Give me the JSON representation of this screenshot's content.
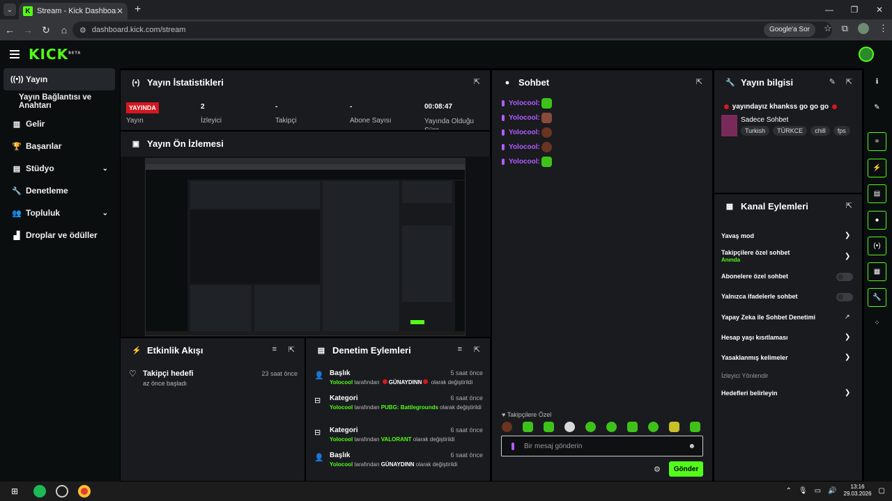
{
  "browser": {
    "tab_title": "Stream - Kick Dashboard",
    "url": "dashboard.kick.com/stream",
    "ask_google": "Google'a Sor"
  },
  "kick": {
    "logo": "KICK",
    "beta": "BETA"
  },
  "sidebar": {
    "items": [
      {
        "label": "Yayın",
        "icon": "broadcast-icon"
      },
      {
        "label": "Yayın Bağlantısı ve Anahtarı"
      },
      {
        "label": "Gelir",
        "icon": "revenue-icon"
      },
      {
        "label": "Başarılar",
        "icon": "trophy-icon"
      },
      {
        "label": "Stüdyo",
        "icon": "studio-icon"
      },
      {
        "label": "Denetleme",
        "icon": "wrench-icon"
      },
      {
        "label": "Topluluk",
        "icon": "community-icon"
      },
      {
        "label": "Droplar ve ödüller",
        "icon": "drops-icon"
      }
    ]
  },
  "stats": {
    "title": "Yayın İstatistikleri",
    "live": "YAYINDA",
    "live_label": "Yayın",
    "viewers_value": "2",
    "viewers_label": "İzleyici",
    "followers_value": "-",
    "followers_label": "Takipçi",
    "subs_value": "-",
    "subs_label": "Abone Sayısı",
    "uptime_value": "00:08:47",
    "uptime_label": "Yayında Olduğu Süre"
  },
  "preview": {
    "title": "Yayın Ön İzlemesi"
  },
  "events": {
    "title": "Etkinlik Akışı",
    "item_title": "Takipçi hedefi",
    "item_sub": "az önce başladı",
    "item_time": "23 saat önce"
  },
  "mod": {
    "title": "Denetim Eylemleri",
    "items": [
      {
        "type": "Başlık",
        "time": "5 saat önce",
        "user": "Yolocool",
        "by": "tarafından",
        "value": "GÜNAYDINN",
        "suffix": "olarak değiştirildi"
      },
      {
        "type": "Kategori",
        "time": "6 saat önce",
        "user": "Yolocool",
        "by": "tarafından",
        "value": "PUBG: Battlegrounds",
        "suffix": "olarak değiştirildi"
      },
      {
        "type": "Kategori",
        "time": "6 saat önce",
        "user": "Yolocool",
        "by": "tarafından",
        "value": "VALORANT",
        "suffix": "olarak değiştirildi"
      },
      {
        "type": "Başlık",
        "time": "6 saat önce",
        "user": "Yolocool",
        "by": "tarafından",
        "value": "GÜNAYDINN",
        "suffix": "olarak değiştirildi"
      }
    ]
  },
  "chat": {
    "title": "Sohbet",
    "user": "Yolocool:",
    "followers_only": "Takipçilere Özel",
    "placeholder": "Bir mesaj gönderin",
    "send": "Gönder"
  },
  "info": {
    "title": "Yayın bilgisi",
    "stream_title": "yayındayız khankss go go go",
    "category": "Sadece Sohbet",
    "tags": [
      "Turkish",
      "TÜRKCE",
      "chill",
      "fps"
    ]
  },
  "channel": {
    "title": "Kanal Eylemleri",
    "slow": "Yavaş mod",
    "followers": "Takipçilere özel sohbet",
    "followers_sub": "Anında",
    "subs": "Abonelere özel sohbet",
    "emotes": "Yalnızca ifadelerle sohbet",
    "ai": "Yapay Zeka ile Sohbet Denetimi",
    "age": "Hesap yaşı kısıtlaması",
    "banned": "Yasaklanmış kelimeler",
    "redirect": "İzleyici Yönlendir",
    "goals": "Hedefleri belirleyin"
  },
  "taskbar": {
    "time": "13:16",
    "date": "29.03.2026"
  },
  "colors": {
    "accent": "#53fc18",
    "live": "#d3181f",
    "chat_user": "#b25cff",
    "panel": "#191b1f"
  }
}
